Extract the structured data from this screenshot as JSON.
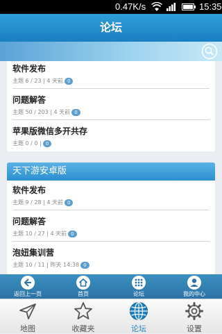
{
  "status": {
    "speed": "0.47K/s",
    "time": "15:35"
  },
  "header": {
    "title": "论坛"
  },
  "icons": {
    "search": "search-icon",
    "back": "back-arrow-icon",
    "home": "home-icon",
    "grid": "grid-icon",
    "user": "user-icon"
  },
  "section1": {
    "items": [
      {
        "title": "软件发布",
        "meta": "主题 6 / 23 | 4 天前",
        "badge": "0"
      },
      {
        "title": "问题解答",
        "meta": "主题 50 / 203 | 4 天前",
        "badge": "0"
      },
      {
        "title": "苹果版微信多开共存",
        "meta": "主题 0 / 0 |",
        "badge": "0"
      }
    ]
  },
  "section2": {
    "title": "天下游安卓版",
    "items": [
      {
        "title": "软件发布",
        "meta": "主题 9 / 28 | 4 天前",
        "badge": "0"
      },
      {
        "title": "问题解答",
        "meta": "主题 10 / 27 | 4 天前",
        "badge": "0"
      },
      {
        "title": "泡妞集训营",
        "meta": "主题 10 / 11 | 昨天 14:38",
        "badge": "0"
      }
    ]
  },
  "quickbar": {
    "back": "返回上一页",
    "home": "首页",
    "forum": "论坛",
    "mine": "我的中心"
  },
  "tabs": {
    "map": "地图",
    "favorites": "收藏夹",
    "forum": "论坛",
    "settings": "设置"
  },
  "colors": {
    "accent": "#1a7fc1",
    "active_tab": "#1a7fc1"
  }
}
